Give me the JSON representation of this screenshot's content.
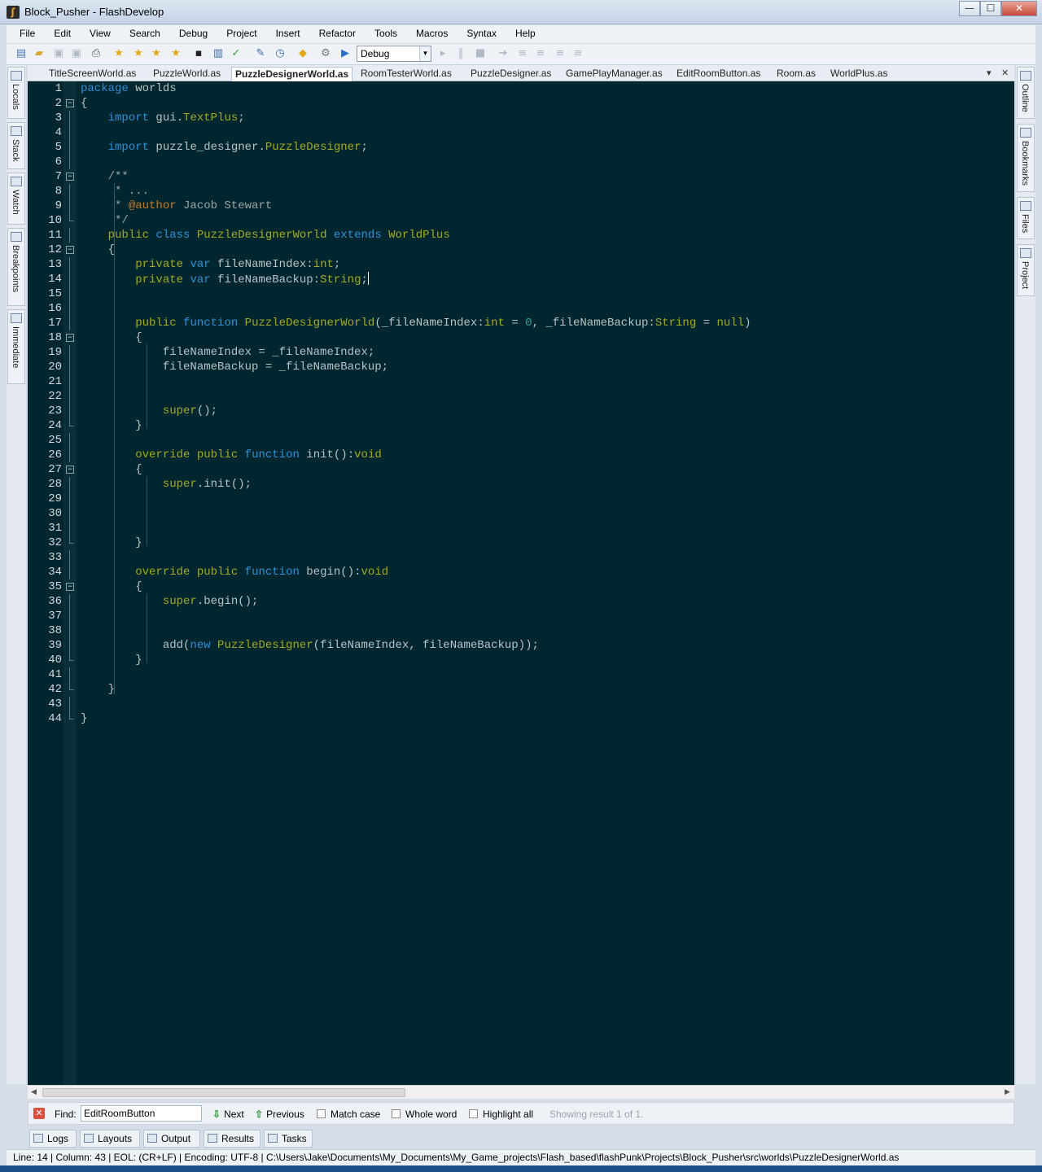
{
  "window": {
    "title": "Block_Pusher - FlashDevelop",
    "minimize": "—",
    "maximize": "☐",
    "close": "✕"
  },
  "menu": [
    "File",
    "Edit",
    "View",
    "Search",
    "Debug",
    "Project",
    "Insert",
    "Refactor",
    "Tools",
    "Macros",
    "Syntax",
    "Help"
  ],
  "toolbar": {
    "configuration": "Debug"
  },
  "left_panels": [
    "Locals",
    "Stack",
    "Watch",
    "Breakpoints",
    "Immediate"
  ],
  "right_panels": [
    "Outline",
    "Bookmarks",
    "Files",
    "Project"
  ],
  "tabs": [
    {
      "label": "TitleScreenWorld.as",
      "active": false
    },
    {
      "label": "PuzzleWorld.as",
      "active": false
    },
    {
      "label": "PuzzleDesignerWorld.as",
      "active": true
    },
    {
      "label": "RoomTesterWorld.as",
      "active": false
    },
    {
      "label": "PuzzleDesigner.as",
      "active": false
    },
    {
      "label": "GamePlayManager.as",
      "active": false
    },
    {
      "label": "EditRoomButton.as",
      "active": false
    },
    {
      "label": "Room.as",
      "active": false
    },
    {
      "label": "WorldPlus.as",
      "active": false
    }
  ],
  "code_lines": [
    "package worlds",
    "{",
    "    import gui.TextPlus;",
    "",
    "    import puzzle_designer.PuzzleDesigner;",
    "",
    "    /**",
    "     * ...",
    "     * @author Jacob Stewart",
    "     */",
    "    public class PuzzleDesignerWorld extends WorldPlus",
    "    {",
    "        private var fileNameIndex:int;",
    "        private var fileNameBackup:String;",
    "",
    "",
    "        public function PuzzleDesignerWorld(_fileNameIndex:int = 0, _fileNameBackup:String = null)",
    "        {",
    "            fileNameIndex = _fileNameIndex;",
    "            fileNameBackup = _fileNameBackup;",
    "",
    "",
    "            super();",
    "        }",
    "",
    "        override public function init():void",
    "        {",
    "            super.init();",
    "",
    "",
    "",
    "        }",
    "",
    "        override public function begin():void",
    "        {",
    "            super.begin();",
    "",
    "",
    "            add(new PuzzleDesigner(fileNameIndex, fileNameBackup));",
    "        }",
    "",
    "    }",
    "",
    "}"
  ],
  "find": {
    "label": "Find:",
    "value": "EditRoomButton",
    "next": "Next",
    "previous": "Previous",
    "match_case": "Match case",
    "whole_word": "Whole word",
    "highlight_all": "Highlight all",
    "status": "Showing result 1 of 1."
  },
  "panels": [
    "Logs",
    "Layouts",
    "Output",
    "Results",
    "Tasks"
  ],
  "status": {
    "line": "Line: 14",
    "column": "Column: 43",
    "eol": "EOL: (CR+LF)",
    "encoding": "Encoding: UTF-8",
    "path": "C:\\Users\\Jake\\Documents\\My_Documents\\My_Game_projects\\Flash_based\\flashPunk\\Projects\\Block_Pusher\\src\\worlds\\PuzzleDesignerWorld.as"
  },
  "colors": {
    "editor_bg": "#00262f",
    "keyword": "#2f8fd8",
    "type": "#a4ab24",
    "annotation": "#c77b2a",
    "number": "#2aa198"
  },
  "caret": {
    "line": 14,
    "column": 43
  }
}
